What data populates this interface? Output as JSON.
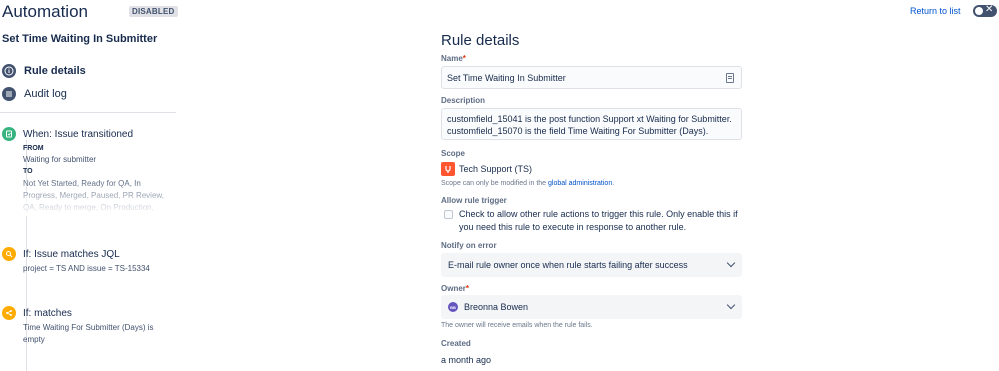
{
  "header": {
    "app_title": "Automation",
    "status_badge": "DISABLED",
    "rule_name": "Set Time Waiting In Submitter",
    "return_link": "Return to list",
    "toggle_icon": "close-x-icon",
    "toggle_on": false
  },
  "sidebar": {
    "nav": [
      {
        "label": "Rule details",
        "icon": "info-icon",
        "active": true
      },
      {
        "label": "Audit log",
        "icon": "list-icon",
        "active": false
      }
    ]
  },
  "timeline": {
    "trigger": {
      "title": "When: Issue transitioned",
      "from_label": "FROM",
      "from_value": "Waiting for submitter",
      "to_label": "TO",
      "to_value": "Not Yet Started, Ready for QA, In Progress, Merged, Paused, PR Review, QA, Ready to merge, On Production,",
      "icon": "transition-icon",
      "color": "#36B37E"
    },
    "condition1": {
      "title": "If: Issue matches JQL",
      "detail": "project = TS AND issue = TS-15334",
      "icon": "search-icon",
      "color": "#FFAB00"
    },
    "condition2": {
      "title": "If: matches",
      "detail": "Time Waiting For Submitter (Days) is empty",
      "icon": "branch-icon",
      "color": "#FFAB00"
    }
  },
  "details": {
    "title": "Rule details",
    "name_label": "Name",
    "name_value": "Set Time Waiting In Submitter",
    "description_label": "Description",
    "description_value": "customfield_15041 is the post function Support xt Waiting for Submitter. customfield_15070 is the field Time Waiting For Submitter (Days).",
    "scope_label": "Scope",
    "scope_value": "Tech Support (TS)",
    "scope_note_prefix": "Scope can only be modified in the ",
    "scope_note_link": "global administration",
    "scope_note_suffix": ".",
    "allow_trigger_label": "Allow rule trigger",
    "allow_trigger_text": "Check to allow other rule actions to trigger this rule. Only enable this if you need this rule to execute in response to another rule.",
    "allow_trigger_checked": false,
    "notify_label": "Notify on error",
    "notify_value": "E-mail rule owner once when rule starts failing after success",
    "owner_label": "Owner",
    "owner_initials": "BB",
    "owner_value": "Breonna Bowen",
    "owner_note": "The owner will receive emails when the rule fails.",
    "created_label": "Created",
    "created_value": "a month ago",
    "required_mark": "*"
  }
}
